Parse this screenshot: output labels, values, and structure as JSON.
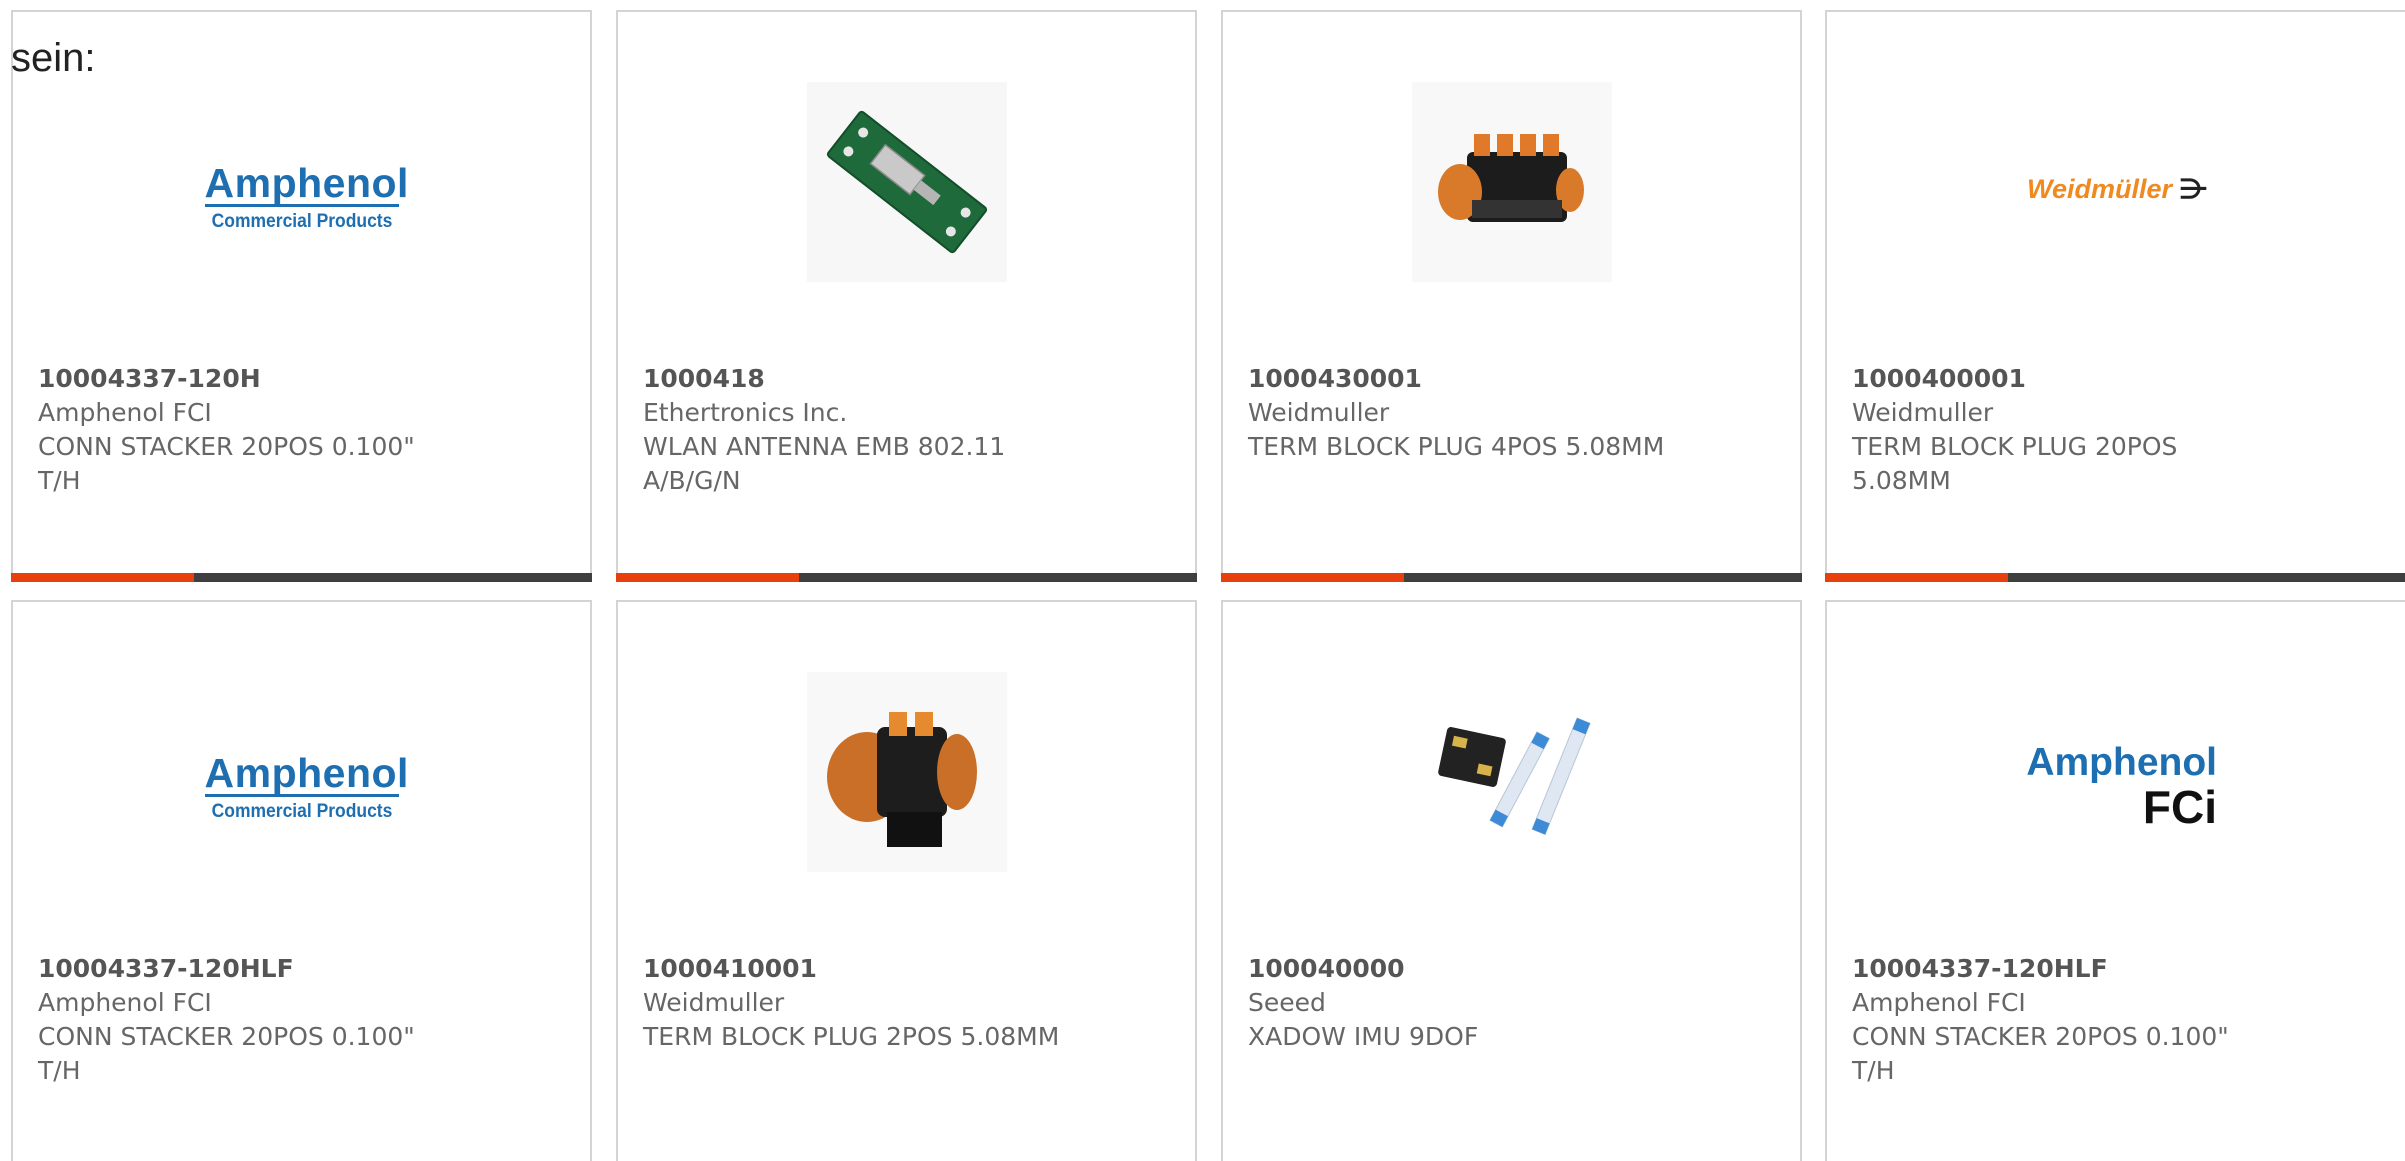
{
  "intro": {
    "text": "sein:"
  },
  "colors": {
    "accent": "#e8400c",
    "bar": "#3f3f3f",
    "card_border": "#d4d4d4",
    "text": "#666666",
    "amphenol_blue": "#1e6fb1",
    "weidmuller_orange": "#f08a1f"
  },
  "products": [
    {
      "part_number": "10004337-120H",
      "manufacturer": "Amphenol FCI",
      "description": "CONN STACKER 20POS 0.100\" T/H",
      "image": "amphenol-commercial-products-logo",
      "logo_big": "Amphenol",
      "logo_small": "Commercial Products"
    },
    {
      "part_number": "1000418",
      "manufacturer": "Ethertronics Inc.",
      "description": "WLAN ANTENNA EMB 802.11 A/B/G/N",
      "image": "pcb-antenna-photo"
    },
    {
      "part_number": "1000430001",
      "manufacturer": "Weidmuller",
      "description": "TERM BLOCK PLUG 4POS 5.08MM",
      "image": "terminal-block-4pos-photo"
    },
    {
      "part_number": "1000400001",
      "manufacturer": "Weidmuller",
      "description": "TERM BLOCK PLUG 20POS 5.08MM",
      "image": "weidmuller-logo",
      "logo_text": "Weidmüller",
      "logo_mark": "⋺"
    },
    {
      "part_number": "10004337-120HLF",
      "manufacturer": "Amphenol FCI",
      "description": "CONN STACKER 20POS 0.100\" T/H",
      "image": "amphenol-commercial-products-logo",
      "logo_big": "Amphenol",
      "logo_small": "Commercial Products"
    },
    {
      "part_number": "1000410001",
      "manufacturer": "Weidmuller",
      "description": "TERM BLOCK PLUG 2POS 5.08MM",
      "image": "terminal-block-2pos-photo"
    },
    {
      "part_number": "100040000",
      "manufacturer": "Seeed",
      "description": "XADOW IMU 9DOF",
      "image": "xadow-imu-board-photo"
    },
    {
      "part_number": "10004337-120HLF",
      "manufacturer": "Amphenol FCI",
      "description": "CONN STACKER 20POS 0.100\" T/H",
      "image": "amphenol-fci-logo",
      "logo_big": "Amphenol",
      "logo_fci": "FCi"
    }
  ]
}
